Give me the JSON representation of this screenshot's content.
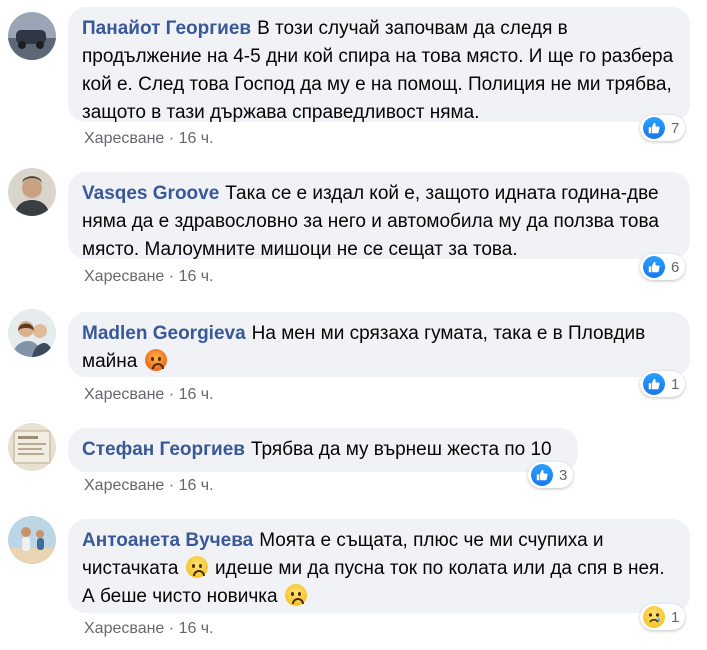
{
  "comments": [
    {
      "author": "Панайот Георгиев",
      "text": "В този случай започвам да следя в продължение на 4-5 дни кой спира на това място. И ще го разбера кой е. След това Господ да му е на помощ. Полиция не ми трябва, защото в тази държава справедливост няма.",
      "like_label": "Харесване",
      "separator": "·",
      "time": "16 ч.",
      "reaction": "like",
      "reaction_count": "7",
      "avatar_color": "#8a96a8"
    },
    {
      "author": "Vasqes Groove",
      "text": "Така се е издал кой е, защото идната година-две няма да е здравословно за него и автомобила му да ползва това място. Малоумните мишоци не се сещат за това.",
      "like_label": "Харесване",
      "separator": "·",
      "time": "16 ч.",
      "reaction": "like",
      "reaction_count": "6",
      "avatar_color": "#7a6a5a"
    },
    {
      "author": "Madlen Georgieva",
      "text": "На мен ми срязаха гумата, така е в Пловдив майна",
      "emoji_after": "angry-face",
      "like_label": "Харесване",
      "separator": "·",
      "time": "16 ч.",
      "reaction": "like",
      "reaction_count": "1",
      "avatar_color": "#c9d4dc"
    },
    {
      "author": "Стефан Георгиев",
      "text": "Трябва да му върнеш жеста по 10",
      "like_label": "Харесване",
      "separator": "·",
      "time": "16 ч.",
      "reaction": "like",
      "reaction_count": "3",
      "avatar_color": "#d8cdb8"
    },
    {
      "author": "Антоанета Вучева",
      "text_part1": "Моята е същата, плюс че ми счупиха и чистачката",
      "text_part2": "идеше ми да пусна ток по колата или да спя в нея. А беше чисто новичка",
      "emoji_inline": "frowning-face",
      "like_label": "Харесване",
      "separator": "·",
      "time": "16 ч.",
      "reaction": "sad",
      "reaction_count": "1",
      "avatar_color": "#a9c7d8"
    }
  ],
  "colors": {
    "author": "#385898",
    "bubble": "#f0f2f5",
    "meta": "#65676b",
    "like_blue": "#1877f2"
  }
}
